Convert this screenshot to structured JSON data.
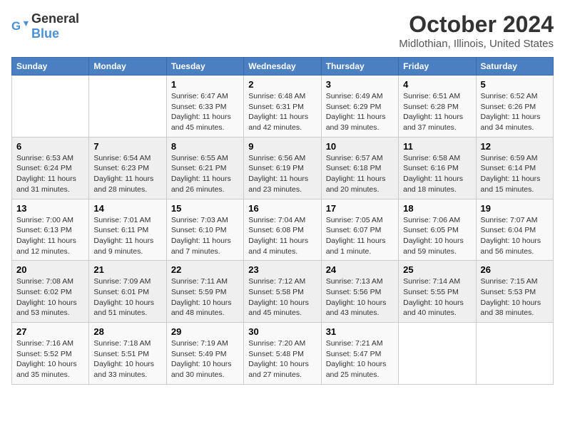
{
  "logo": {
    "general": "General",
    "blue": "Blue"
  },
  "header": {
    "title": "October 2024",
    "subtitle": "Midlothian, Illinois, United States"
  },
  "weekdays": [
    "Sunday",
    "Monday",
    "Tuesday",
    "Wednesday",
    "Thursday",
    "Friday",
    "Saturday"
  ],
  "weeks": [
    [
      null,
      null,
      {
        "day": 1,
        "sunrise": "6:47 AM",
        "sunset": "6:33 PM",
        "daylight": "11 hours and 45 minutes."
      },
      {
        "day": 2,
        "sunrise": "6:48 AM",
        "sunset": "6:31 PM",
        "daylight": "11 hours and 42 minutes."
      },
      {
        "day": 3,
        "sunrise": "6:49 AM",
        "sunset": "6:29 PM",
        "daylight": "11 hours and 39 minutes."
      },
      {
        "day": 4,
        "sunrise": "6:51 AM",
        "sunset": "6:28 PM",
        "daylight": "11 hours and 37 minutes."
      },
      {
        "day": 5,
        "sunrise": "6:52 AM",
        "sunset": "6:26 PM",
        "daylight": "11 hours and 34 minutes."
      }
    ],
    [
      {
        "day": 6,
        "sunrise": "6:53 AM",
        "sunset": "6:24 PM",
        "daylight": "11 hours and 31 minutes."
      },
      {
        "day": 7,
        "sunrise": "6:54 AM",
        "sunset": "6:23 PM",
        "daylight": "11 hours and 28 minutes."
      },
      {
        "day": 8,
        "sunrise": "6:55 AM",
        "sunset": "6:21 PM",
        "daylight": "11 hours and 26 minutes."
      },
      {
        "day": 9,
        "sunrise": "6:56 AM",
        "sunset": "6:19 PM",
        "daylight": "11 hours and 23 minutes."
      },
      {
        "day": 10,
        "sunrise": "6:57 AM",
        "sunset": "6:18 PM",
        "daylight": "11 hours and 20 minutes."
      },
      {
        "day": 11,
        "sunrise": "6:58 AM",
        "sunset": "6:16 PM",
        "daylight": "11 hours and 18 minutes."
      },
      {
        "day": 12,
        "sunrise": "6:59 AM",
        "sunset": "6:14 PM",
        "daylight": "11 hours and 15 minutes."
      }
    ],
    [
      {
        "day": 13,
        "sunrise": "7:00 AM",
        "sunset": "6:13 PM",
        "daylight": "11 hours and 12 minutes."
      },
      {
        "day": 14,
        "sunrise": "7:01 AM",
        "sunset": "6:11 PM",
        "daylight": "11 hours and 9 minutes."
      },
      {
        "day": 15,
        "sunrise": "7:03 AM",
        "sunset": "6:10 PM",
        "daylight": "11 hours and 7 minutes."
      },
      {
        "day": 16,
        "sunrise": "7:04 AM",
        "sunset": "6:08 PM",
        "daylight": "11 hours and 4 minutes."
      },
      {
        "day": 17,
        "sunrise": "7:05 AM",
        "sunset": "6:07 PM",
        "daylight": "11 hours and 1 minute."
      },
      {
        "day": 18,
        "sunrise": "7:06 AM",
        "sunset": "6:05 PM",
        "daylight": "10 hours and 59 minutes."
      },
      {
        "day": 19,
        "sunrise": "7:07 AM",
        "sunset": "6:04 PM",
        "daylight": "10 hours and 56 minutes."
      }
    ],
    [
      {
        "day": 20,
        "sunrise": "7:08 AM",
        "sunset": "6:02 PM",
        "daylight": "10 hours and 53 minutes."
      },
      {
        "day": 21,
        "sunrise": "7:09 AM",
        "sunset": "6:01 PM",
        "daylight": "10 hours and 51 minutes."
      },
      {
        "day": 22,
        "sunrise": "7:11 AM",
        "sunset": "5:59 PM",
        "daylight": "10 hours and 48 minutes."
      },
      {
        "day": 23,
        "sunrise": "7:12 AM",
        "sunset": "5:58 PM",
        "daylight": "10 hours and 45 minutes."
      },
      {
        "day": 24,
        "sunrise": "7:13 AM",
        "sunset": "5:56 PM",
        "daylight": "10 hours and 43 minutes."
      },
      {
        "day": 25,
        "sunrise": "7:14 AM",
        "sunset": "5:55 PM",
        "daylight": "10 hours and 40 minutes."
      },
      {
        "day": 26,
        "sunrise": "7:15 AM",
        "sunset": "5:53 PM",
        "daylight": "10 hours and 38 minutes."
      }
    ],
    [
      {
        "day": 27,
        "sunrise": "7:16 AM",
        "sunset": "5:52 PM",
        "daylight": "10 hours and 35 minutes."
      },
      {
        "day": 28,
        "sunrise": "7:18 AM",
        "sunset": "5:51 PM",
        "daylight": "10 hours and 33 minutes."
      },
      {
        "day": 29,
        "sunrise": "7:19 AM",
        "sunset": "5:49 PM",
        "daylight": "10 hours and 30 minutes."
      },
      {
        "day": 30,
        "sunrise": "7:20 AM",
        "sunset": "5:48 PM",
        "daylight": "10 hours and 27 minutes."
      },
      {
        "day": 31,
        "sunrise": "7:21 AM",
        "sunset": "5:47 PM",
        "daylight": "10 hours and 25 minutes."
      },
      null,
      null
    ]
  ]
}
